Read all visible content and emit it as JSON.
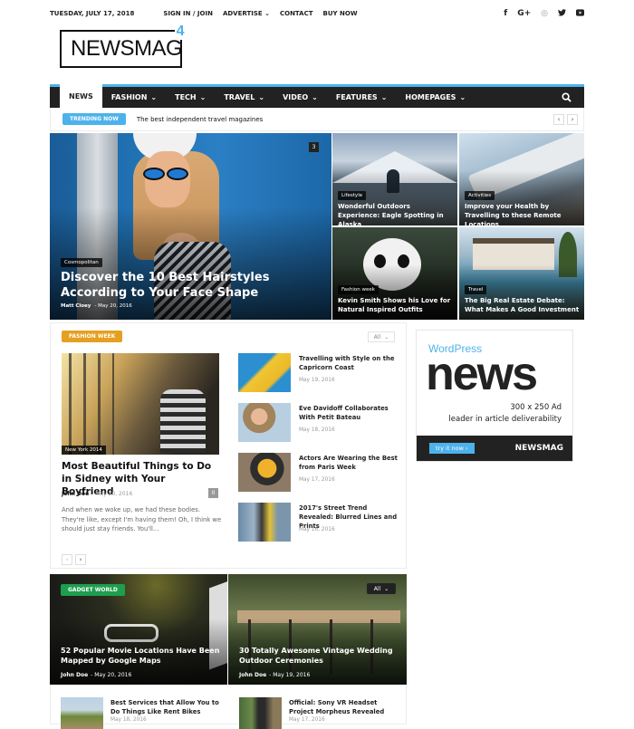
{
  "topbar": {
    "date": "TUESDAY, JULY 17, 2018",
    "links": [
      "SIGN IN / JOIN",
      "ADVERTISE",
      "CONTACT",
      "BUY NOW"
    ],
    "advertise_chevron": "⌄",
    "social": [
      {
        "name": "facebook-icon",
        "glyph": "f"
      },
      {
        "name": "google-plus-icon",
        "glyph": "G+"
      },
      {
        "name": "instagram-icon",
        "glyph": "◎"
      },
      {
        "name": "twitter-icon",
        "glyph": "🐦"
      },
      {
        "name": "youtube-icon",
        "glyph": "▶"
      }
    ]
  },
  "logo": {
    "text": "NEWSMAG",
    "version": "4"
  },
  "nav": {
    "items": [
      {
        "label": "NEWS",
        "active": true,
        "chevron": ""
      },
      {
        "label": "FASHION",
        "chevron": "⌄"
      },
      {
        "label": "TECH",
        "chevron": "⌄"
      },
      {
        "label": "TRAVEL",
        "chevron": "⌄"
      },
      {
        "label": "VIDEO",
        "chevron": "⌄"
      },
      {
        "label": "FEATURES",
        "chevron": "⌄"
      },
      {
        "label": "HOMEPAGES",
        "chevron": "⌄"
      }
    ],
    "search_glyph": "🔍"
  },
  "trending": {
    "badge": "TRENDING NOW",
    "headline": "The best independent travel magazines",
    "prev": "‹",
    "next": "›"
  },
  "hero": {
    "big": {
      "category": "Cosmopolitan",
      "title": "Discover the 10 Best Hairstyles According to Your Face Shape",
      "author": "Matt Cloey",
      "date": "May 20, 2016",
      "comments": "3"
    },
    "tiles": [
      {
        "category": "Lifestyle",
        "title": "Wonderful Outdoors Experience: Eagle Spotting in Alaska"
      },
      {
        "category": "Activities",
        "title": "Improve your Health by Travelling to these Remote Locations"
      },
      {
        "category": "Fashion week",
        "title": "Kevin Smith Shows his Love for Natural Inspired Outfits"
      },
      {
        "category": "Travel",
        "title": "The Big Real Estate Debate: What Makes A Good Investment"
      }
    ]
  },
  "fashion_block": {
    "badge": "FASHION WEEK",
    "badge_color": "#e5a021",
    "filter": "All",
    "featured": {
      "category": "New York 2014",
      "title": "Most Beautiful Things to Do in Sidney with Your Boyfriend",
      "author": "John Doe",
      "date": "May 20, 2016",
      "comments": "0",
      "excerpt": "And when we woke up, we had these bodies. They're like, except I'm having them! Oh, I think we should just stay friends. You'll..."
    },
    "list": [
      {
        "title": "Travelling with Style on the Capricorn Coast",
        "date": "May 19, 2016"
      },
      {
        "title": "Eve Davidoff Collaborates With Petit Bateau",
        "date": "May 18, 2016"
      },
      {
        "title": "Actors Are Wearing the Best from Paris Week",
        "date": "May 17, 2016"
      },
      {
        "title": "2017's Street Trend Revealed: Blurred Lines and Prints",
        "date": "May 16, 2016"
      }
    ],
    "prev": "‹",
    "next": "›"
  },
  "ad": {
    "wordpress": "WordPress",
    "news": "news",
    "size": "300 x 250 Ad",
    "tagline": "leader in article deliverability",
    "cta": "try it now ›",
    "brand": "NEWSMAG"
  },
  "gadget_block": {
    "badge": "GADGET WORLD",
    "badge_color": "#1e9e4f",
    "filter": "All",
    "big": [
      {
        "title": "52 Popular Movie Locations Have Been Mapped by Google Maps",
        "author": "John Doe",
        "date": "May 20, 2016"
      },
      {
        "title": "30 Totally Awesome Vintage Wedding Outdoor Ceremonies",
        "author": "John Doe",
        "date": "May 19, 2016"
      }
    ],
    "list": [
      {
        "title": "Best Services that Allow You to Do Things Like Rent Bikes",
        "date": "May 18, 2016"
      },
      {
        "title": "Official: Sony VR Headset Project Morpheus Revealed",
        "date": "May 17, 2016"
      }
    ]
  },
  "colors": {
    "accent": "#4db2ec",
    "nav_bg": "#222222"
  }
}
